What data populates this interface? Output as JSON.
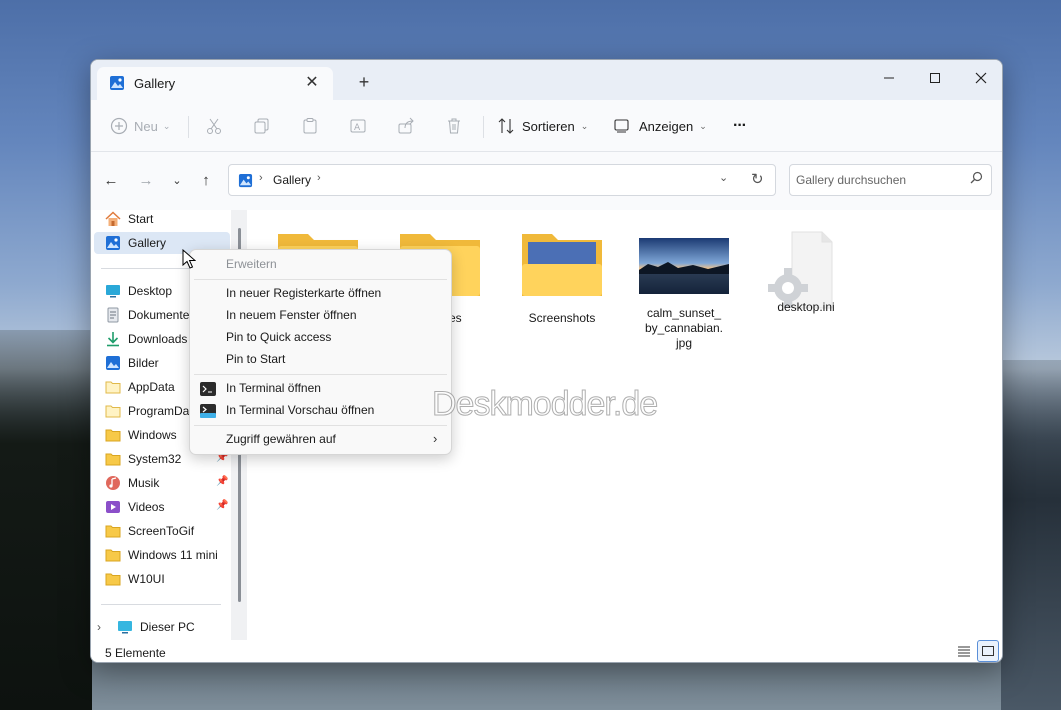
{
  "tab": {
    "title": "Gallery"
  },
  "toolbar": {
    "new_label": "Neu",
    "sort_label": "Sortieren",
    "view_label": "Anzeigen",
    "more_label": "···"
  },
  "address": {
    "crumb": "Gallery"
  },
  "search": {
    "placeholder": "Gallery durchsuchen"
  },
  "sidebar": {
    "items": [
      {
        "label": "Start"
      },
      {
        "label": "Gallery"
      },
      {
        "label": "Desktop"
      },
      {
        "label": "Dokumente"
      },
      {
        "label": "Downloads"
      },
      {
        "label": "Bilder"
      },
      {
        "label": "AppData"
      },
      {
        "label": "ProgramData"
      },
      {
        "label": "Windows"
      },
      {
        "label": "System32"
      },
      {
        "label": "Musik"
      },
      {
        "label": "Videos"
      },
      {
        "label": "ScreenToGif"
      },
      {
        "label": "Windows 11 mini"
      },
      {
        "label": "W10UI"
      },
      {
        "label": "Dieser PC"
      }
    ]
  },
  "files": [
    {
      "name": ""
    },
    {
      "name": "Pictures"
    },
    {
      "name": "Screenshots"
    },
    {
      "name": "calm_sunset_by_cannabian.jpg"
    },
    {
      "name": "desktop.ini"
    }
  ],
  "context_menu": {
    "items": [
      {
        "label": "Erweitern"
      },
      {
        "label": "In neuer Registerkarte öffnen"
      },
      {
        "label": "In neuem Fenster öffnen"
      },
      {
        "label": "Pin to Quick access"
      },
      {
        "label": "Pin to Start"
      },
      {
        "label": "In  Terminal öffnen"
      },
      {
        "label": "In Terminal  Vorschau öffnen"
      },
      {
        "label": "Zugriff gewähren auf"
      }
    ]
  },
  "status": {
    "count": "5 Elemente"
  },
  "watermark": "Deskmodder.de"
}
